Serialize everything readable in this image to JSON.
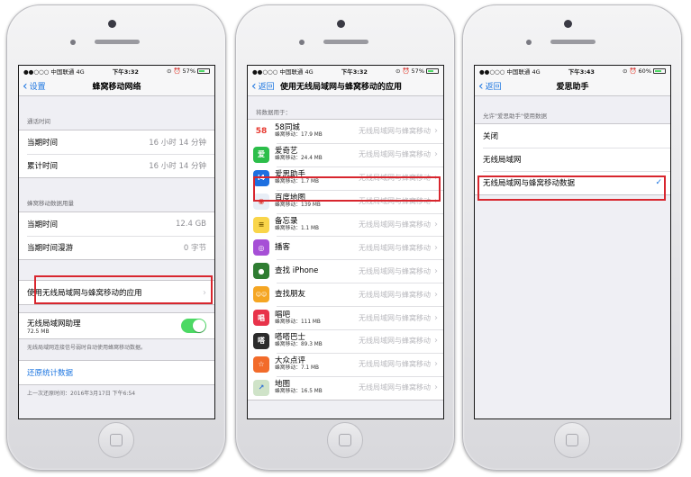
{
  "common": {
    "carrier": "●●○○○ 中国联通  4G",
    "chevron_back": "‹",
    "chevron_right": "›"
  },
  "phone1": {
    "status": {
      "time": "下午3:32",
      "battery": "57%"
    },
    "nav": {
      "back": "设置",
      "title": "蜂窝移动网络"
    },
    "section_call": "通话时间",
    "call_rows": [
      {
        "label": "当期时间",
        "value": "16 小时 14 分钟"
      },
      {
        "label": "累计时间",
        "value": "16 小时 14 分钟"
      }
    ],
    "section_data": "蜂窝移动数据用量",
    "data_rows": [
      {
        "label": "当期时间",
        "value": "12.4 GB"
      },
      {
        "label": "当期时间漫游",
        "value": "0 字节"
      }
    ],
    "apps_row": "使用无线局域网与蜂窝移动的应用",
    "wifi_assist": {
      "label": "无线局域网助理",
      "sub": "72.5 MB",
      "footer": "无线局域网连接信号弱时自动使用蜂窝移动数据。"
    },
    "reset": "还原统计数据",
    "last_reset": "上一次还原时间：2016年3月17日 下午6:54"
  },
  "phone2": {
    "status": {
      "time": "下午3:32",
      "battery": "57%"
    },
    "nav": {
      "back": "返回",
      "title": "使用无线局域网与蜂窝移动的应用"
    },
    "section": "将数据用于：",
    "value_text": "无线局域网与蜂窝移动",
    "apps": [
      {
        "name": "58同城",
        "usage": "蜂窝移动：17.9 MB",
        "icon": "58-tongcheng-icon",
        "color": "#ffffff"
      },
      {
        "name": "爱奇艺",
        "usage": "蜂窝移动：24.4 MB",
        "icon": "iqiyi-icon",
        "color": "#2cbe4a"
      },
      {
        "name": "爱思助手",
        "usage": "蜂窝移动：1.7 MB",
        "icon": "i4-assistant-icon",
        "color": "#1e6fe0"
      },
      {
        "name": "百度地图",
        "usage": "蜂窝移动：139 MB",
        "icon": "baidu-map-icon",
        "color": "#e8eef6"
      },
      {
        "name": "备忘录",
        "usage": "蜂窝移动：1.1 MB",
        "icon": "notes-icon",
        "color": "#f9d54a"
      },
      {
        "name": "播客",
        "usage": "",
        "icon": "podcast-icon",
        "color": "#a64fd6"
      },
      {
        "name": "查找 iPhone",
        "usage": "",
        "icon": "find-iphone-icon",
        "color": "#2f7d32"
      },
      {
        "name": "查找朋友",
        "usage": "",
        "icon": "find-friends-icon",
        "color": "#f5a623"
      },
      {
        "name": "唱吧",
        "usage": "蜂窝移动：111 MB",
        "icon": "changba-icon",
        "color": "#e8334a"
      },
      {
        "name": "嗒嗒巴士",
        "usage": "蜂窝移动：89.3 MB",
        "icon": "dada-bus-icon",
        "color": "#2b2b2b"
      },
      {
        "name": "大众点评",
        "usage": "蜂窝移动：7.1 MB",
        "icon": "dianping-icon",
        "color": "#f26b2a"
      },
      {
        "name": "地图",
        "usage": "蜂窝移动：16.5 MB",
        "icon": "maps-icon",
        "color": "#cfe3c8"
      }
    ]
  },
  "phone3": {
    "status": {
      "time": "下午3:43",
      "battery": "60%"
    },
    "nav": {
      "back": "返回",
      "title": "爱思助手"
    },
    "section": "允许\"爱思助手\"使用数据",
    "options": [
      "关闭",
      "无线局域网",
      "无线局域网与蜂窝移动数据"
    ],
    "check": "✓"
  }
}
